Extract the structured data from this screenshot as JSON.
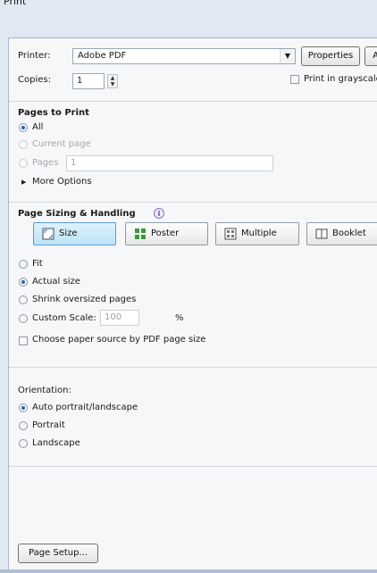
{
  "window": {
    "title": "Print"
  },
  "printer": {
    "label": "Printer:",
    "value": "Adobe PDF",
    "properties_label": "Properties",
    "advanced_label": "A",
    "copies_label": "Copies:",
    "copies_value": "1",
    "grayscale_label": "Print in grayscale"
  },
  "pages": {
    "title": "Pages to Print",
    "all_label": "All",
    "current_label": "Current page",
    "pages_label": "Pages",
    "pages_value": "1",
    "more_label": "More Options"
  },
  "sizing": {
    "title": "Page Sizing & Handling",
    "buttons": {
      "size": "Size",
      "poster": "Poster",
      "multiple": "Multiple",
      "booklet": "Booklet"
    },
    "fit_label": "Fit",
    "actual_label": "Actual size",
    "shrink_label": "Shrink oversized pages",
    "custom_label": "Custom Scale:",
    "custom_value": "100",
    "percent": "%",
    "paper_source_label": "Choose paper source by PDF page size"
  },
  "orientation": {
    "title": "Orientation:",
    "auto_label": "Auto portrait/landscape",
    "portrait_label": "Portrait",
    "landscape_label": "Landscape"
  },
  "footer": {
    "page_setup_label": "Page Setup..."
  },
  "colors": {
    "accent": "#2a62b5",
    "frame": "#dfe8f3",
    "selected_button": "#bde3f8"
  }
}
